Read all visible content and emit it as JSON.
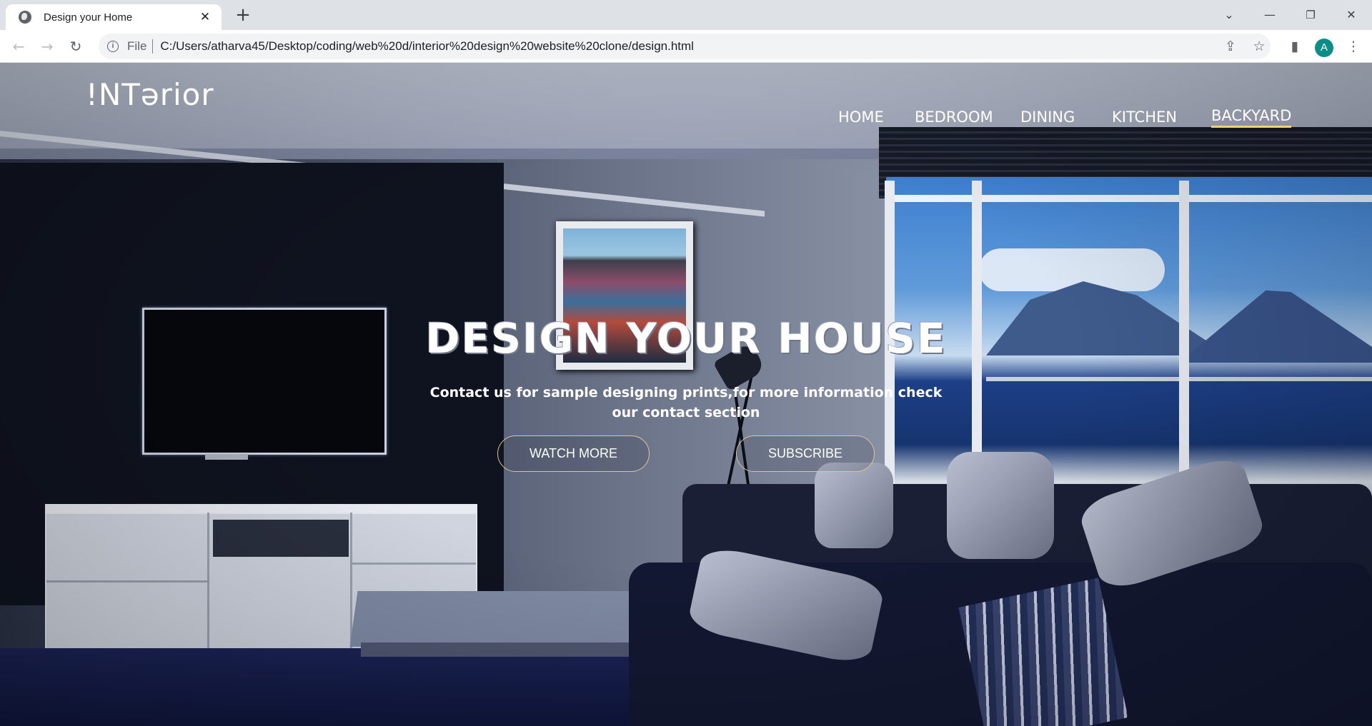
{
  "browser": {
    "tab_title": "Design your Home",
    "new_tab_label": "+",
    "close_tab_glyph": "✕",
    "address_scheme": "File",
    "address_url": "C:/Users/atharva45/Desktop/coding/web%20d/interior%20design%20website%20clone/design.html",
    "profile_initial": "A",
    "icons": [
      "globe-icon",
      "back-icon",
      "forward-icon",
      "reload-icon",
      "info-icon",
      "share-icon",
      "star-icon",
      "side-panel-icon",
      "kebab-menu-icon",
      "tab-search-icon",
      "minimize-icon",
      "restore-icon",
      "close-window-icon"
    ]
  },
  "site": {
    "logo": "!NTərior",
    "nav": [
      {
        "label": "HOME"
      },
      {
        "label": "BEDROOM"
      },
      {
        "label": "DINING"
      },
      {
        "label": "KITCHEN"
      },
      {
        "label": "BACKYARD",
        "active": true
      }
    ],
    "hero": {
      "title": "DESIGN YOUR HOUSE",
      "subtitle": "Contact us for sample designing prints,for more information check our contact section",
      "buttons": [
        {
          "label": "WATCH MORE"
        },
        {
          "label": "SUBSCRIBE"
        }
      ]
    }
  },
  "colors": {
    "accent_underline": "#f4d06f",
    "button_border": "#e0c58f",
    "profile_avatar": "#0b8d8a"
  }
}
